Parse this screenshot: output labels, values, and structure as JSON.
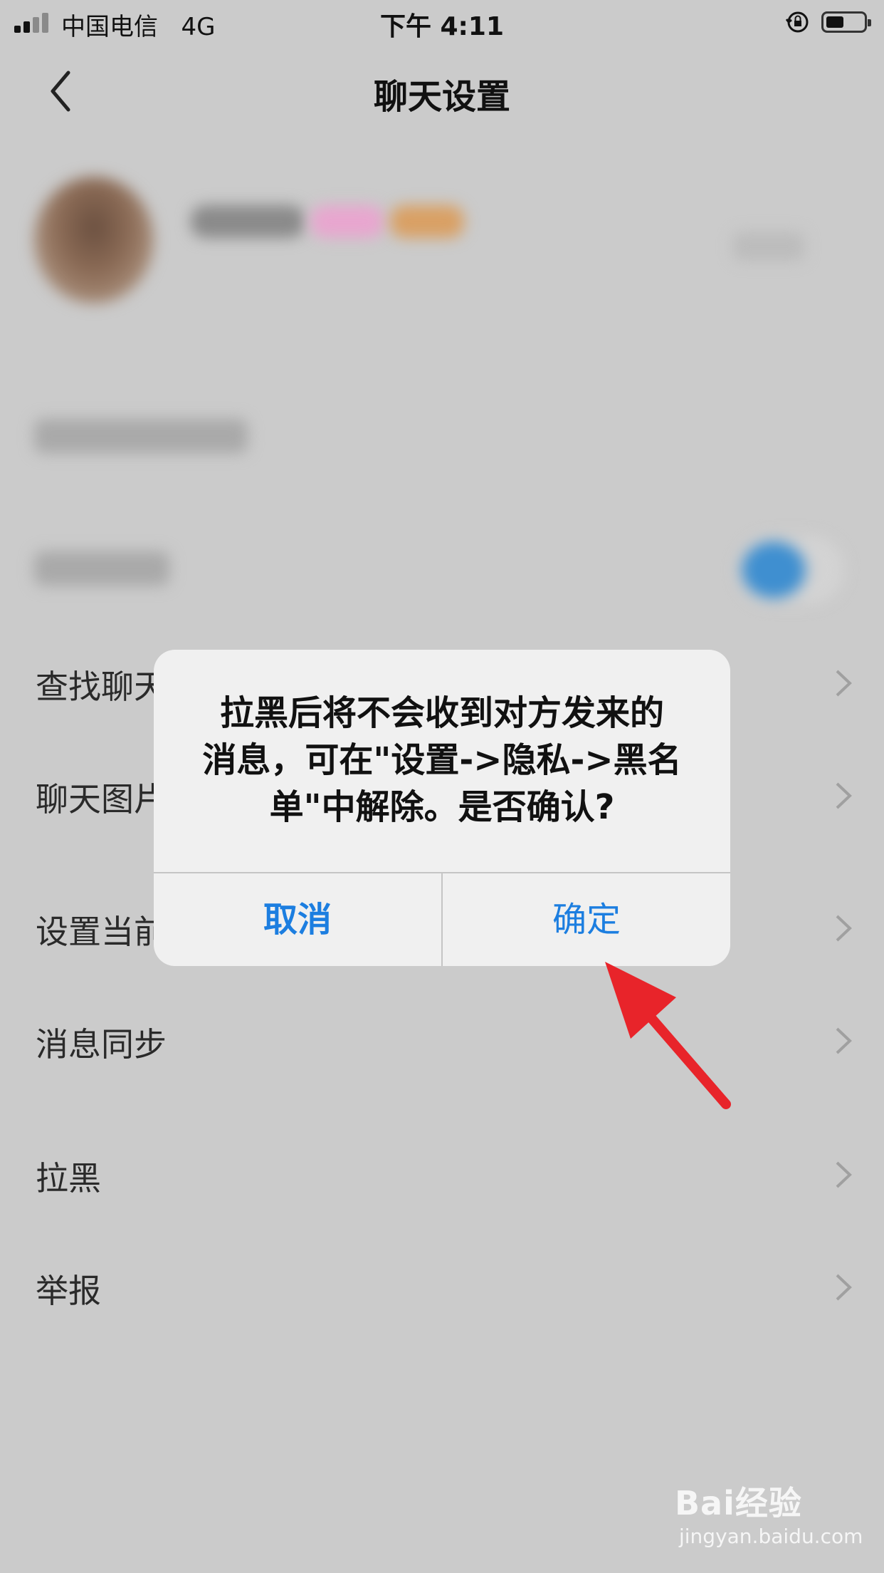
{
  "status_bar": {
    "carrier": "中国电信",
    "network": "4G",
    "time": "下午 4:11"
  },
  "nav": {
    "title": "聊天设置",
    "back_icon": "chevron-left-icon"
  },
  "settings": {
    "rows": [
      {
        "label": "查找聊天"
      },
      {
        "label": "聊天图片"
      },
      {
        "label": "设置当前"
      },
      {
        "label": "消息同步"
      },
      {
        "label": "拉黑"
      },
      {
        "label": "举报"
      }
    ]
  },
  "dialog": {
    "line1": "拉黑后将不会收到对方发来的",
    "line2": "消息，可在\"设置->隐私->黑名",
    "line3": "单\"中解除。是否确认?",
    "cancel_label": "取消",
    "confirm_label": "确定"
  },
  "watermark": {
    "main": "Bai经验",
    "sub": "jingyan.baidu.com"
  },
  "colors": {
    "background": "#cbcbcb",
    "dialog_bg": "#f0f0f0",
    "button_text": "#1c7ee0",
    "arrow": "#e8242a",
    "toggle_on": "#3f8fd0"
  }
}
